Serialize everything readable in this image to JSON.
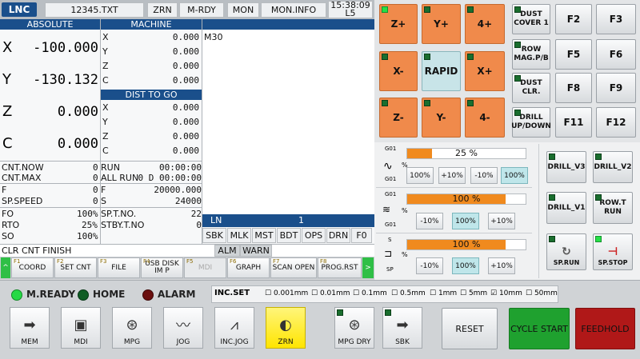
{
  "header": {
    "logo": "LNC",
    "filename": "12345.TXT",
    "mode": "ZRN",
    "status": "M-RDY",
    "mon": "MON",
    "mon_info": "MON.INFO",
    "time": "15:38:09",
    "level": "L5"
  },
  "absolute": {
    "title": "ABSOLUTE",
    "rows": [
      {
        "axis": "X",
        "value": "-100.000"
      },
      {
        "axis": "Y",
        "value": "-130.132"
      },
      {
        "axis": "Z",
        "value": "0.000"
      },
      {
        "axis": "C",
        "value": "0.000"
      }
    ]
  },
  "machine": {
    "title": "MACHINE",
    "rows": [
      {
        "axis": "X",
        "value": "0.000"
      },
      {
        "axis": "Y",
        "value": "0.000"
      },
      {
        "axis": "Z",
        "value": "0.000"
      },
      {
        "axis": "C",
        "value": "0.000"
      }
    ]
  },
  "dist_to_go": {
    "title": "DIST TO GO",
    "rows": [
      {
        "axis": "X",
        "value": "0.000"
      },
      {
        "axis": "Y",
        "value": "0.000"
      },
      {
        "axis": "Z",
        "value": "0.000"
      },
      {
        "axis": "C",
        "value": "0.000"
      }
    ]
  },
  "program": {
    "text": "M30"
  },
  "counters": {
    "cnt_now_label": "CNT.NOW",
    "cnt_now": "0",
    "cnt_max_label": "CNT.MAX",
    "cnt_max": "0",
    "run_label": "RUN",
    "run": "00:00:00",
    "all_run_label": "ALL RUN",
    "all_run": "0  D  00:00:00"
  },
  "spindle": {
    "f_label": "F",
    "f_left": "0",
    "f_right_label": "F",
    "f_right": "20000.000",
    "sp_speed_label": "SP.SPEED",
    "sp_speed": "0",
    "s_label": "S",
    "s": "24000",
    "fo_label": "FO",
    "fo": "100%",
    "sp_t_no_label": "SP.T.NO.",
    "sp_t_no": "22",
    "rto_label": "RTO",
    "rto": "25%",
    "stby_t_no_label": "STBY.T.NO",
    "stby_t_no": "0",
    "so_label": "SO",
    "so": "100%"
  },
  "ln": {
    "label": "LN",
    "value": "1"
  },
  "modes": [
    "SBK",
    "MLK",
    "MST",
    "BDT",
    "OPS",
    "DRN",
    "F0"
  ],
  "message": {
    "text": "CLR CNT FINISH",
    "alm": "ALM",
    "warn": "WARN"
  },
  "fkeys": [
    {
      "num": "F1",
      "label": "COORD"
    },
    {
      "num": "F2",
      "label": "SET CNT"
    },
    {
      "num": "F3",
      "label": "FILE"
    },
    {
      "num": "F4",
      "label": "USB DISK IM P"
    },
    {
      "num": "F5",
      "label": "MDI"
    },
    {
      "num": "F6",
      "label": "GRAPH"
    },
    {
      "num": "F7",
      "label": "SCAN OPEN"
    },
    {
      "num": "F8",
      "label": "PROG.RST"
    }
  ],
  "jog": {
    "z_plus": "Z+",
    "y_plus": "Y+",
    "four_plus": "4+",
    "x_minus": "X-",
    "rapid": "RAPID",
    "x_plus": "X+",
    "z_minus": "Z-",
    "y_minus": "Y-",
    "four_minus": "4-"
  },
  "func_keys": [
    {
      "label": "DUST COVER 1"
    },
    {
      "label": "F2"
    },
    {
      "label": "F3"
    },
    {
      "label": "ROW MAG.P/B"
    },
    {
      "label": "F5"
    },
    {
      "label": "F6"
    },
    {
      "label": "DUST CLR."
    },
    {
      "label": "F8"
    },
    {
      "label": "F9"
    },
    {
      "label": "DRILL UP/DOWN"
    },
    {
      "label": "F11"
    },
    {
      "label": "F12"
    }
  ],
  "feed_override": {
    "g01_top": "G01",
    "g01_bottom": "G01",
    "pct_sign": "%",
    "value": "25 %",
    "level": 0.25,
    "buttons": [
      "100%",
      "+10%",
      "-10%",
      "100%"
    ]
  },
  "rapid_override": {
    "g01_top": "G01",
    "g01_bottom": "G01",
    "pct_sign": "%",
    "value": "100 %",
    "level": 1.0,
    "buttons": [
      "-10%",
      "100%",
      "+10%"
    ]
  },
  "spindle_override": {
    "s_label": "S",
    "sp_label": "SP",
    "pct_sign": "%",
    "value": "100 %",
    "level": 1.0,
    "buttons": [
      "-10%",
      "100%",
      "+10%"
    ]
  },
  "drill_keys": {
    "drill_v3": "DRILL_V3",
    "drill_v2": "DRILL_V2",
    "drill_v1": "DRILL_V1",
    "row_t_run": "ROW.T RUN",
    "sp_run": "SP.RUN",
    "sp_stop": "SP.STOP"
  },
  "status_leds": {
    "m_ready": "M.READY",
    "home": "HOME",
    "alarm": "ALARM"
  },
  "inc_set": {
    "label": "INC.SET",
    "options": [
      "0.001mm",
      "0.01mm",
      "0.1mm",
      "0.5mm",
      "1mm",
      "5mm",
      "10mm",
      "50mm"
    ],
    "checked": "10mm"
  },
  "mode_buttons": [
    {
      "label": "MEM"
    },
    {
      "label": "MDI"
    },
    {
      "label": "MPG"
    },
    {
      "label": "JOG"
    },
    {
      "label": "INC.JOG"
    },
    {
      "label": "ZRN"
    },
    {
      "label": "MPG DRY"
    },
    {
      "label": "SBK"
    }
  ],
  "bottom_keys": {
    "reset": "RESET",
    "cycle_start": "CYCLE START",
    "feedhold": "FEEDHOLD"
  },
  "colors": {
    "header_blue": "#1a4f8b",
    "jog_orange": "#f08a4b",
    "cycle_green": "#1fa12f",
    "feedhold_red": "#b01818"
  }
}
